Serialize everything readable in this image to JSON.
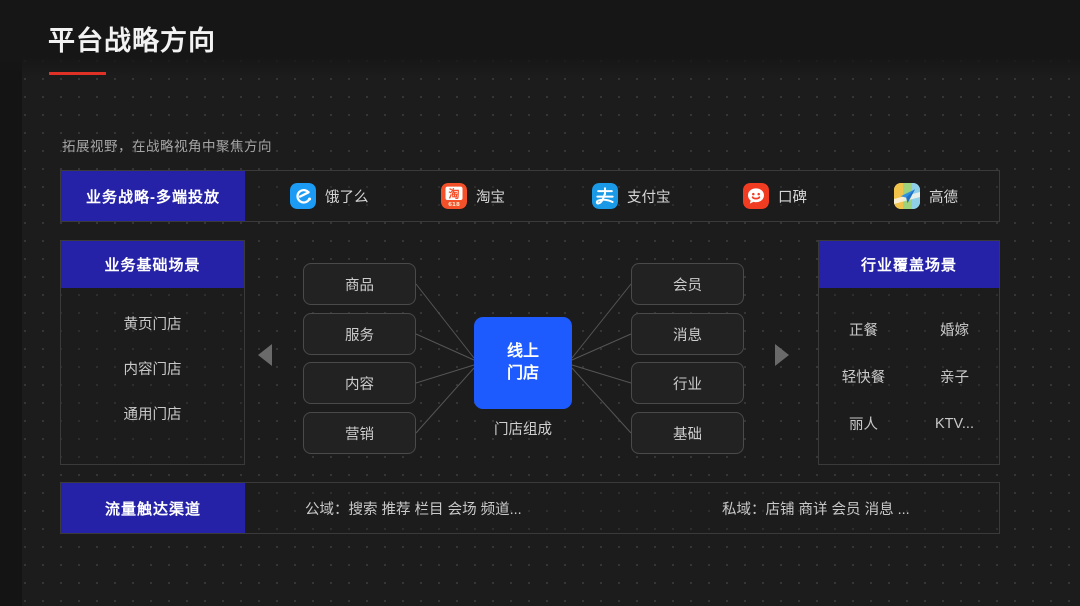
{
  "header": {
    "title": "平台战略方向",
    "accent_color": "#e03127",
    "subtitle": "拓展视野，在战略视角中聚焦方向"
  },
  "theme": {
    "background": "#1c1c1c",
    "panel_header_blue": "#2622a8",
    "center_node_blue": "#1e5bff",
    "border": "#3a3a3a",
    "text_primary": "#f2f2f2",
    "text_secondary": "#c9c9c9"
  },
  "channels_row": {
    "label": "业务战略-多端投放",
    "items": [
      {
        "name": "饿了么",
        "icon": "eleme-icon"
      },
      {
        "name": "淘宝",
        "icon": "taobao-icon"
      },
      {
        "name": "支付宝",
        "icon": "alipay-icon"
      },
      {
        "name": "口碑",
        "icon": "koubei-icon"
      },
      {
        "name": "高德",
        "icon": "amap-icon"
      }
    ]
  },
  "base_scenarios": {
    "label": "业务基础场景",
    "items": [
      "黄页门店",
      "内容门店",
      "通用门店"
    ]
  },
  "diagram": {
    "left_nodes": [
      "商品",
      "服务",
      "内容",
      "营销"
    ],
    "center_node": {
      "line1": "线上",
      "line2": "门店"
    },
    "center_caption": "门店组成",
    "right_nodes": [
      "会员",
      "消息",
      "行业",
      "基础"
    ]
  },
  "industry_scenarios": {
    "label": "行业覆盖场景",
    "items": [
      "正餐",
      "婚嫁",
      "轻快餐",
      "亲子",
      "丽人",
      "KTV..."
    ]
  },
  "traffic_row": {
    "label": "流量触达渠道",
    "public": "公域：搜索 推荐 栏目 会场 频道...",
    "private": "私域：店铺 商详 会员 消息 ..."
  }
}
